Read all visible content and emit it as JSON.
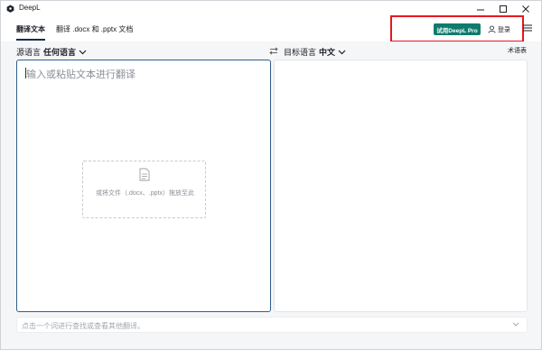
{
  "window": {
    "title": "DeepL",
    "controls": [
      "minimize-icon",
      "maximize-icon",
      "close-icon"
    ]
  },
  "header": {
    "tabs": [
      {
        "label": "翻译文本",
        "active": true
      },
      {
        "label": "翻译 .docx 和 .pptx 文档",
        "active": false
      }
    ],
    "pro_button": "试用DeepL Pro",
    "login_label": "登录",
    "colors": {
      "pro_button": "#0f7b6c",
      "highlight": "#e8171f",
      "tab_underline": "#0f2b46"
    }
  },
  "langbar": {
    "source_prefix": "源语言",
    "source_value": "任何语言",
    "target_prefix": "目标语言",
    "target_value": "中文",
    "glossary": "术语表"
  },
  "source_panel": {
    "placeholder": "输入或粘贴文本进行翻译",
    "dropzone_text": "或将文件（.docx、.pptx）拖放至此"
  },
  "bottom_bar": {
    "hint": "点击一个词进行查找或查看其他翻译。"
  }
}
